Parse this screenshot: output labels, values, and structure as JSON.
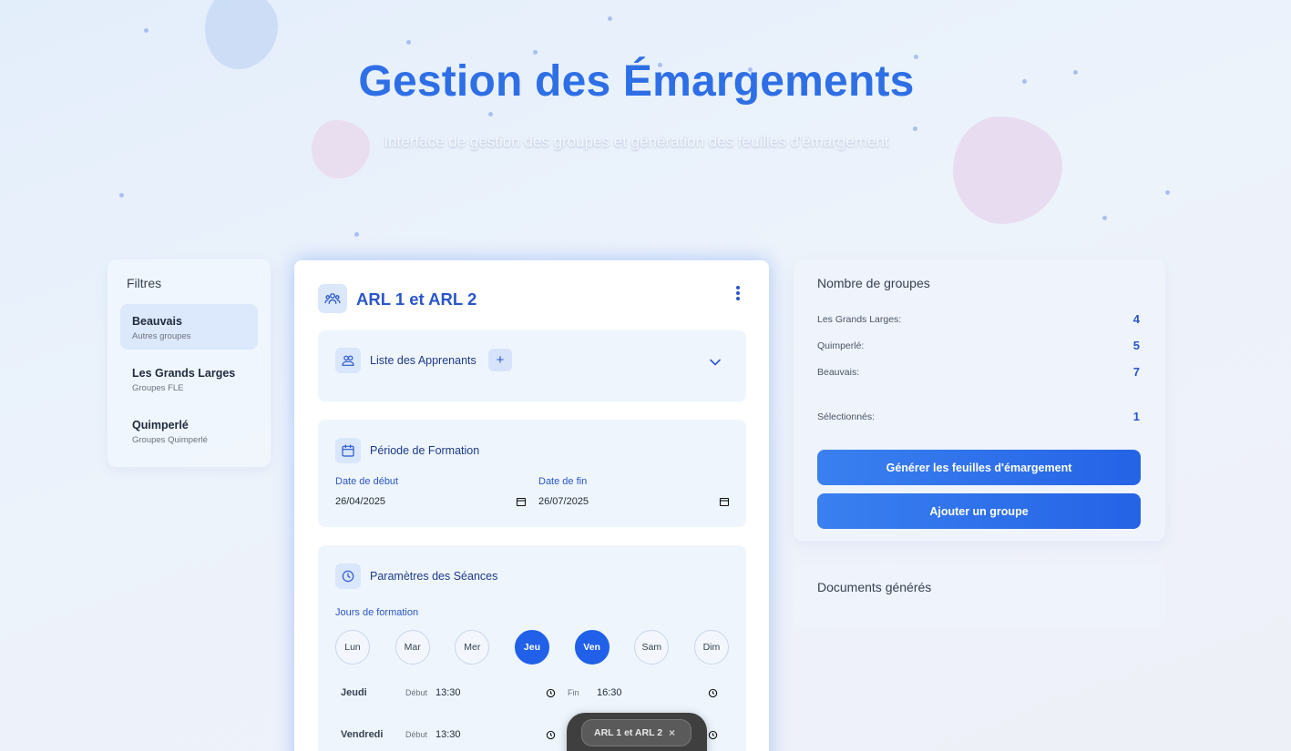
{
  "header": {
    "title": "Gestion des Émargements",
    "subtitle": "Interface de gestion des groupes et génération des feuilles d'émargement"
  },
  "filters": {
    "title": "Filtres",
    "items": [
      {
        "name": "Beauvais",
        "sub": "Autres groupes",
        "active": true
      },
      {
        "name": "Les Grands Larges",
        "sub": "Groupes FLE",
        "active": false
      },
      {
        "name": "Quimperlé",
        "sub": "Groupes Quimperlé",
        "active": false
      }
    ]
  },
  "group": {
    "title": "ARL 1 et ARL 2",
    "learners": {
      "title": "Liste des Apprenants",
      "add_label": "+"
    },
    "period": {
      "title": "Période de Formation",
      "start_label": "Date de début",
      "start_value": "26/04/2025",
      "end_label": "Date de fin",
      "end_value": "26/07/2025"
    },
    "sessions": {
      "title": "Paramètres des Séances",
      "days_label": "Jours de formation",
      "days": [
        {
          "label": "Lun",
          "selected": false
        },
        {
          "label": "Mar",
          "selected": false
        },
        {
          "label": "Mer",
          "selected": false
        },
        {
          "label": "Jeu",
          "selected": true
        },
        {
          "label": "Ven",
          "selected": true
        },
        {
          "label": "Sam",
          "selected": false
        },
        {
          "label": "Dim",
          "selected": false
        }
      ],
      "rows": [
        {
          "day": "Jeudi",
          "start_label": "Début",
          "start": "13:30",
          "end_label": "Fin",
          "end": "16:30"
        },
        {
          "day": "Vendredi",
          "start_label": "Début",
          "start": "13:30",
          "end_label": "",
          "end": ""
        }
      ]
    }
  },
  "stats": {
    "title": "Nombre de groupes",
    "items": [
      {
        "label": "Les Grands Larges:",
        "value": "4"
      },
      {
        "label": "Quimperlé:",
        "value": "5"
      },
      {
        "label": "Beauvais:",
        "value": "7"
      }
    ],
    "selected_label": "Sélectionnés:",
    "selected_value": "1",
    "generate_button": "Générer les feuilles d'émargement",
    "add_button": "Ajouter un groupe"
  },
  "documents": {
    "title": "Documents générés"
  },
  "selection_bar": {
    "chip_label": "ARL 1 et ARL 2",
    "close": "×"
  },
  "colors": {
    "accent": "#2160e8",
    "title": "#2e6fe6",
    "label": "#2a56c9"
  },
  "icons": [
    "users-icon",
    "people-icon",
    "calendar-icon",
    "clock-icon",
    "chevron-down-icon",
    "kebab-menu-icon",
    "close-icon"
  ]
}
